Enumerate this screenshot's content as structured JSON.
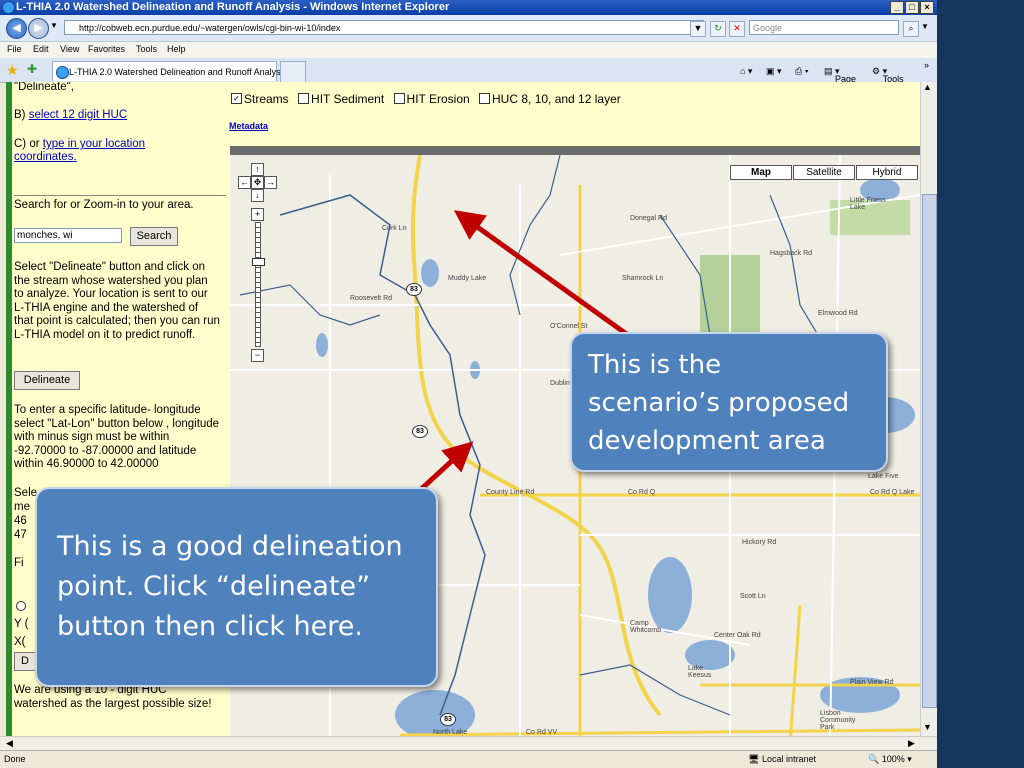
{
  "window": {
    "title": "L-THIA 2.0 Watershed Delineation and Runoff Analysis - Windows Internet Explorer"
  },
  "address_bar": {
    "url": "http://cobweb.ecn.purdue.edu/~watergen/owls/cgi-bin-wi-10/index",
    "search_placeholder": "Google"
  },
  "menu": {
    "items": [
      "File",
      "Edit",
      "View",
      "Favorites",
      "Tools",
      "Help"
    ]
  },
  "tab": {
    "label": "L-THIA 2.0 Watershed Delineation and Runoff Analysis"
  },
  "command_bar": {
    "page": "Page",
    "tools": "Tools"
  },
  "left_panel": {
    "delineate_quote": "\"Delineate\",",
    "option_b_prefix": "B)",
    "option_b_link": "select 12 digit HUC",
    "option_c_prefix": "C) or",
    "option_c_link": "type in your location coordinates.",
    "search_heading": "Search for or Zoom-in to your area.",
    "search_value": "monches, wi",
    "search_button": "Search",
    "instructions": "Select \"Delineate\" button and click on the stream whose watershed you plan to analyze. Your location is sent to our L-THIA engine and the watershed of that point is calculated; then you can run L-THIA model on it to predict runoff.",
    "delineate_button": "Delineate",
    "latlon_instructions": "To enter a specific latitude- longitude select \"Lat-Lon\" button below , longitude with minus sign must be within -92.70000 to -87.00000 and latitude within 46.90000 to 42.00000",
    "partial_sel": "Sele",
    "partial_me": "me",
    "partial_46": "46",
    "partial_47": "47",
    "partial_fi": "Fi",
    "partial_y": "Y (",
    "partial_x": "X(",
    "partial_d": "D",
    "bottom_note": "We are using a 10 - digit HUC watershed as the largest possible size!"
  },
  "layers": {
    "streams": "Streams",
    "hit_sediment": "HIT Sediment",
    "hit_erosion": "HIT Erosion",
    "huc": "HUC 8, 10, and 12 layer",
    "metadata": "Metadata"
  },
  "map": {
    "types": [
      "Map",
      "Satellite",
      "Hybrid"
    ],
    "labels": {
      "cork_ln": "Cork Ln",
      "roosevelt": "Roosevelt Rd",
      "mudlake": "Muddy Lake",
      "shamrock": "Shamrock Ln",
      "donegal": "Donegal Rd",
      "hagsback": "Hagsback Rd",
      "elmwood": "Elmwood Rd",
      "oconnel": "O'Connel St",
      "dublin": "Dublin",
      "county_line": "County Line Rd",
      "co_rd_q": "Co Rd Q",
      "hickory": "Hickory Rd",
      "scott_ln": "Scott Ln",
      "camp": "Camp Whitcomb",
      "center_oak": "Center Oak Rd",
      "lake_keesus": "Lake Keesus",
      "north_lake": "North Lake",
      "co_rd_vv": "Co Rd VV",
      "plain_view": "Plain View Rd",
      "lake_five": "Lake Five",
      "little_friess": "Little Friess Lake",
      "lisbon": "Lisbon Community Park",
      "local_lake": "Co Rd Q Lake",
      "route": "83"
    }
  },
  "status": {
    "left": "Done",
    "zone": "Local intranet",
    "zoom": "100%"
  },
  "callouts": {
    "development": [
      "This is the",
      "scenario’s proposed",
      "development area"
    ],
    "delineation": [
      "This is a good delineation",
      "point. Click “delineate”",
      "button then click here."
    ]
  },
  "colors": {
    "slide_bg": "#17365d",
    "callout_fill": "#4f81bd",
    "arrow": "#c00000",
    "page_bg": "#ffffcc"
  }
}
